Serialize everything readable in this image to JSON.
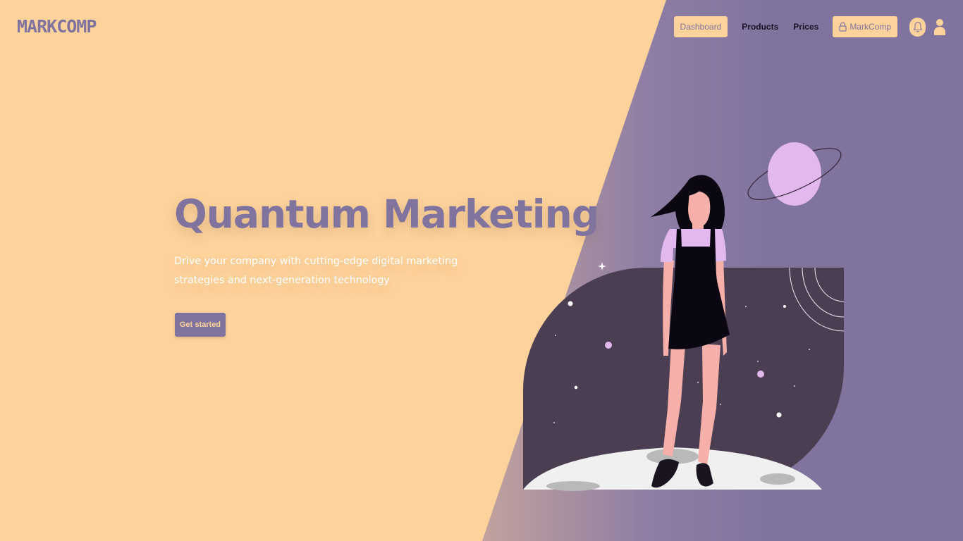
{
  "brand": {
    "logo_text": "MARKCOMP"
  },
  "nav": {
    "dashboard_label": "Dashboard",
    "products_label": "Products",
    "prices_label": "Prices",
    "account_label": "MarkComp",
    "icons": {
      "notifications": "bell-icon",
      "profile": "user-icon",
      "account": "lock-icon"
    }
  },
  "hero": {
    "title": "Quantum Marketing",
    "subtitle": "Drive your company with cutting-edge digital marketing strategies and next-generation technology",
    "cta_label": "Get started"
  },
  "colors": {
    "peach": "#fed29b",
    "purple": "#80749f",
    "dark_space": "#4c3e52",
    "planet": "#e3b8ee",
    "text_dark": "#1c1226"
  }
}
